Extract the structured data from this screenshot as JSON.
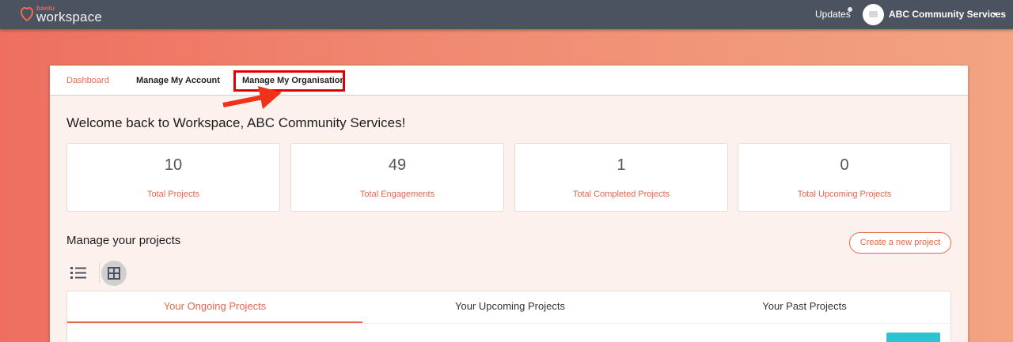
{
  "header": {
    "logo_small": "bantu",
    "logo_big": "workspace",
    "updates_label": "Updates",
    "org_name": "ABC Community Services"
  },
  "tabs": [
    {
      "label": "Dashboard",
      "active": true
    },
    {
      "label": "Manage My Account",
      "active": false
    },
    {
      "label": "Manage My Organisation",
      "active": false
    }
  ],
  "welcome": "Welcome back to Workspace, ABC Community Services!",
  "stats": [
    {
      "value": "10",
      "label": "Total Projects"
    },
    {
      "value": "49",
      "label": "Total Engagements"
    },
    {
      "value": "1",
      "label": "Total Completed Projects"
    },
    {
      "value": "0",
      "label": "Total Upcoming Projects"
    }
  ],
  "projects": {
    "title": "Manage your projects",
    "create_label": "Create a new project",
    "tabs": [
      {
        "label": "Your Ongoing Projects",
        "active": true
      },
      {
        "label": "Your Upcoming Projects",
        "active": false
      },
      {
        "label": "Your Past Projects",
        "active": false
      }
    ]
  },
  "colors": {
    "accent": "#e5674a",
    "topbar": "#4b5260",
    "highlight": "#e00000",
    "teal": "#2cc3d2"
  },
  "icons": [
    "bantu-logo-icon",
    "avatar-icon",
    "chevron-down-icon",
    "list-view-icon",
    "grid-view-icon",
    "annotation-arrow"
  ]
}
